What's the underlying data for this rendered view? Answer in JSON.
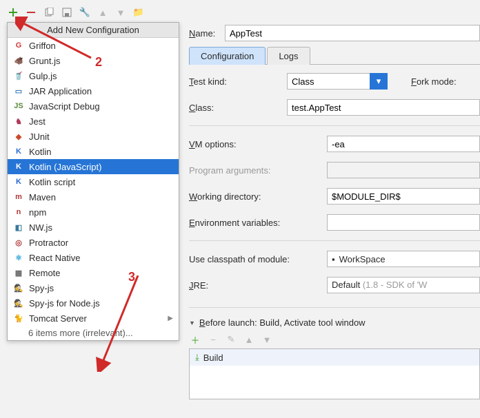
{
  "toolbar": {
    "add": "+",
    "remove": "−"
  },
  "popup_title": "Add New Configuration",
  "configs": [
    {
      "label": "Griffon",
      "color": "#d23a3a",
      "glyph": "G"
    },
    {
      "label": "Grunt.js",
      "color": "#b06a2e",
      "glyph": "🐗"
    },
    {
      "label": "Gulp.js",
      "color": "#d23a3a",
      "glyph": "🥤"
    },
    {
      "label": "JAR Application",
      "color": "#3a7bbf",
      "glyph": "▭"
    },
    {
      "label": "JavaScript Debug",
      "color": "#5a8a3a",
      "glyph": "JS"
    },
    {
      "label": "Jest",
      "color": "#b03a5a",
      "glyph": "♞"
    },
    {
      "label": "JUnit",
      "color": "#c94a2a",
      "glyph": "◆"
    },
    {
      "label": "Kotlin",
      "color": "#2a6bd6",
      "glyph": "K"
    },
    {
      "label": "Kotlin (JavaScript)",
      "color": "#2a6bd6",
      "glyph": "K",
      "sel": true
    },
    {
      "label": "Kotlin script",
      "color": "#2a6bd6",
      "glyph": "K"
    },
    {
      "label": "Maven",
      "color": "#b03a3a",
      "glyph": "m"
    },
    {
      "label": "npm",
      "color": "#b03a3a",
      "glyph": "n"
    },
    {
      "label": "NW.js",
      "color": "#3a7a9d",
      "glyph": "◧"
    },
    {
      "label": "Protractor",
      "color": "#b03a3a",
      "glyph": "◎"
    },
    {
      "label": "React Native",
      "color": "#3aa9d6",
      "glyph": "⚛"
    },
    {
      "label": "Remote",
      "color": "#6a6a6a",
      "glyph": "▦"
    },
    {
      "label": "Spy-js",
      "color": "#d6a23a",
      "glyph": "🕵"
    },
    {
      "label": "Spy-js for Node.js",
      "color": "#d6a23a",
      "glyph": "🕵"
    },
    {
      "label": "Tomcat Server",
      "color": "#b06a2e",
      "glyph": "🐈",
      "sub": true
    }
  ],
  "configs_more": "6 items more (irrelevant)...",
  "name_lbl": "Name:",
  "name_val": "AppTest",
  "tabs": {
    "config": "Configuration",
    "logs": "Logs"
  },
  "form": {
    "testkind_lbl": "Test kind:",
    "testkind_val": "Class",
    "forkmode_lbl": "Fork mode:",
    "class_lbl": "Class:",
    "class_val": "test.AppTest",
    "vm_lbl": "VM options:",
    "vm_val": "-ea",
    "pa_lbl": "Program arguments:",
    "wd_lbl": "Working directory:",
    "wd_val": "$MODULE_DIR$",
    "env_lbl": "Environment variables:",
    "cp_lbl": "Use classpath of module:",
    "cp_val": "WorkSpace",
    "jre_lbl": "JRE:",
    "jre_val": "Default",
    "jre_hint": "(1.8 - SDK of 'W"
  },
  "before_lbl": "Before launch: Build, Activate tool window",
  "build_item": "Build",
  "annot": {
    "a2": "2",
    "a3": "3"
  }
}
